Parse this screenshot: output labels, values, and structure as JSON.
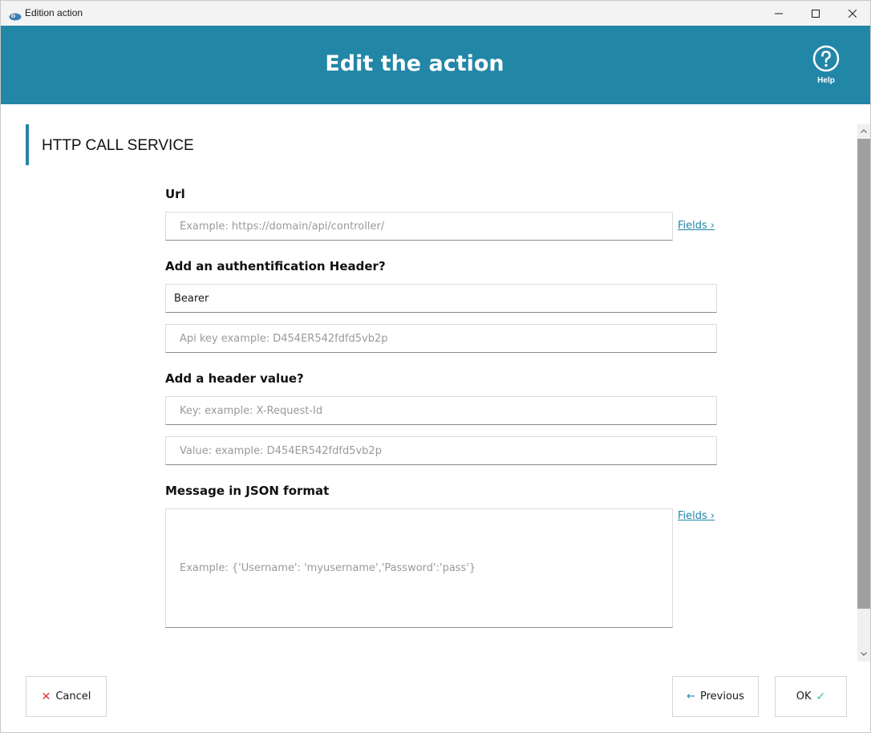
{
  "window": {
    "title": "Edition action",
    "minimize_icon": "minimize-icon",
    "maximize_icon": "maximize-icon",
    "close_icon": "close-icon"
  },
  "header": {
    "title": "Edit the action",
    "help_label": "Help",
    "help_icon": "question-circle-icon",
    "background_color": "#2286a7"
  },
  "section": {
    "title": "HTTP CALL SERVICE",
    "accent_color": "#2286a7"
  },
  "form": {
    "url": {
      "label": "Url",
      "value": "",
      "placeholder": "Example: https://domain/api/controller/",
      "fields_link": "Fields ›"
    },
    "auth": {
      "label": "Add an authentification Header?",
      "type_value": "Bearer",
      "key_value": "",
      "key_placeholder": "Api key example: D454ER542fdfd5vb2p"
    },
    "header_value": {
      "label": "Add a header value?",
      "key_value": "",
      "key_placeholder": "Key: example: X-Request-Id",
      "value_value": "",
      "value_placeholder": "Value: example: D454ER542fdfd5vb2p"
    },
    "message": {
      "label": "Message in JSON format",
      "value": "",
      "placeholder": "Example: {'Username': 'myusername','Password':'pass'}",
      "fields_link": "Fields ›"
    }
  },
  "footer": {
    "cancel_label": "Cancel",
    "cancel_icon": "x-icon",
    "previous_label": "Previous",
    "previous_icon": "arrow-left-icon",
    "ok_label": "OK",
    "ok_icon": "check-icon"
  }
}
